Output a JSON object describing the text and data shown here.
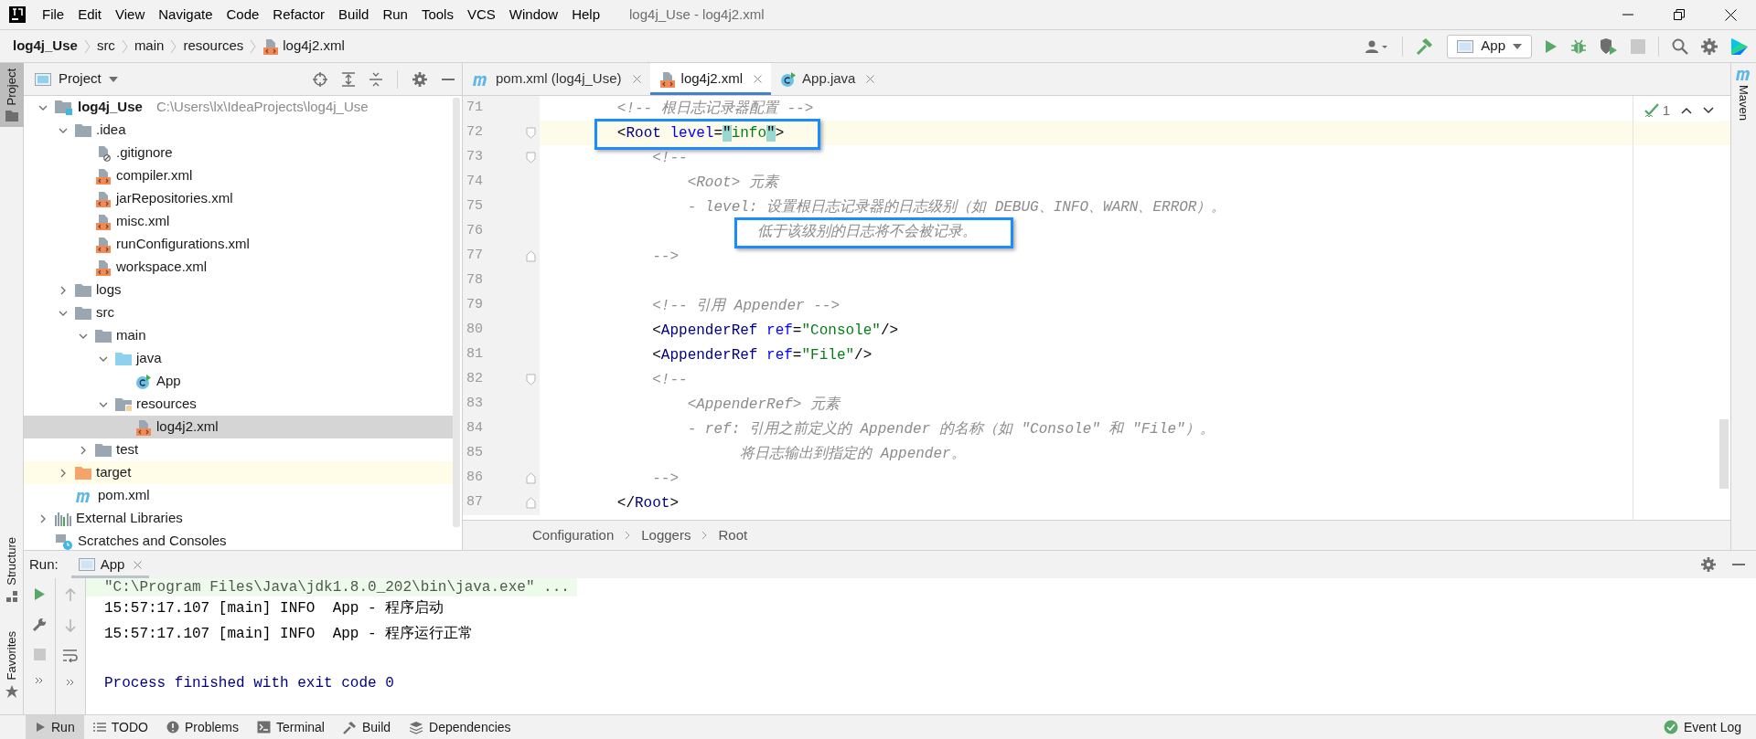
{
  "title_bar": {
    "menus": [
      "File",
      "Edit",
      "View",
      "Navigate",
      "Code",
      "Refactor",
      "Build",
      "Run",
      "Tools",
      "VCS",
      "Window",
      "Help"
    ],
    "title": "log4j_Use - log4j2.xml"
  },
  "nav_bar": {
    "breadcrumbs": [
      {
        "label": "log4j_Use",
        "kind": "project"
      },
      {
        "label": "src",
        "kind": "folder"
      },
      {
        "label": "main",
        "kind": "folder"
      },
      {
        "label": "resources",
        "kind": "folder"
      },
      {
        "label": "log4j2.xml",
        "kind": "xml"
      }
    ],
    "run_config": "App",
    "stop_disabled": true
  },
  "left_stripe": [
    {
      "label": "Project",
      "selected": true
    },
    {
      "label": "Structure",
      "selected": false
    },
    {
      "label": "Favorites",
      "selected": false
    }
  ],
  "right_stripe": [
    "Maven"
  ],
  "project_panel": {
    "title": "Project",
    "tree": [
      {
        "label": "log4j_Use",
        "path": "C:\\Users\\lx\\IdeaProjects\\log4j_Use",
        "kind": "module",
        "expanded": true,
        "selected": false,
        "children": [
          {
            "label": ".idea",
            "kind": "folder",
            "expanded": true,
            "selected": false,
            "children": [
              {
                "label": ".gitignore",
                "kind": "ignored",
                "selected": false
              },
              {
                "label": "compiler.xml",
                "kind": "xml",
                "selected": false
              },
              {
                "label": "jarRepositories.xml",
                "kind": "xml",
                "selected": false
              },
              {
                "label": "misc.xml",
                "kind": "xml",
                "selected": false
              },
              {
                "label": "runConfigurations.xml",
                "kind": "xml",
                "selected": false
              },
              {
                "label": "workspace.xml",
                "kind": "xml",
                "selected": false
              }
            ]
          },
          {
            "label": "logs",
            "kind": "folder",
            "expanded": false,
            "selected": false
          },
          {
            "label": "src",
            "kind": "folder",
            "expanded": true,
            "selected": false,
            "children": [
              {
                "label": "main",
                "kind": "folder",
                "expanded": true,
                "selected": false,
                "children": [
                  {
                    "label": "java",
                    "kind": "source",
                    "expanded": true,
                    "selected": false,
                    "children": [
                      {
                        "label": "App",
                        "kind": "class",
                        "selected": false
                      }
                    ]
                  },
                  {
                    "label": "resources",
                    "kind": "resources",
                    "expanded": true,
                    "selected": false,
                    "children": [
                      {
                        "label": "log4j2.xml",
                        "kind": "xml",
                        "selected": true
                      }
                    ]
                  }
                ]
              },
              {
                "label": "test",
                "kind": "folder",
                "expanded": false,
                "selected": false
              }
            ]
          },
          {
            "label": "target",
            "kind": "excluded",
            "expanded": false,
            "selected": false
          },
          {
            "label": "pom.xml",
            "kind": "maven",
            "selected": false
          }
        ]
      },
      {
        "label": "External Libraries",
        "kind": "libraries",
        "expanded": false,
        "selected": false
      },
      {
        "label": "Scratches and Consoles",
        "kind": "scratches",
        "selected": false
      }
    ]
  },
  "editor": {
    "tabs": [
      {
        "label": "pom.xml (log4j_Use)",
        "kind": "maven",
        "selected": false
      },
      {
        "label": "log4j2.xml",
        "kind": "xml",
        "selected": true
      },
      {
        "label": "App.java",
        "kind": "class",
        "selected": false
      }
    ],
    "inspection_count": "1",
    "lines": [
      {
        "number": "71",
        "kind": "plain",
        "current": false,
        "boxed": false,
        "tokens": [
          {
            "text": "        <!-- 根日志记录器配置 -->",
            "kind": "comment"
          }
        ]
      },
      {
        "number": "72",
        "kind": "opener",
        "current": true,
        "boxed": true,
        "tokens": [
          {
            "text": "        <",
            "kind": "punct"
          },
          {
            "text": "Root",
            "kind": "tag"
          },
          {
            "text": " level",
            "kind": "attr"
          },
          {
            "text": "=",
            "kind": "punct"
          },
          {
            "text": "\"",
            "kind": "match"
          },
          {
            "text": "info",
            "kind": "string",
            "caret_after": true
          },
          {
            "text": "\"",
            "kind": "match"
          },
          {
            "text": ">",
            "kind": "punct"
          }
        ]
      },
      {
        "number": "73",
        "kind": "opener",
        "current": false,
        "boxed": false,
        "tokens": [
          {
            "text": "            <!--",
            "kind": "comment"
          }
        ]
      },
      {
        "number": "74",
        "kind": "plain",
        "current": false,
        "boxed": false,
        "tokens": [
          {
            "text": "                <Root> 元素",
            "kind": "comment"
          }
        ]
      },
      {
        "number": "75",
        "kind": "plain",
        "current": false,
        "boxed": false,
        "tokens": [
          {
            "text": "                - level: 设置根日志记录器的日志级别（如 DEBUG、INFO、WARN、ERROR）。",
            "kind": "comment"
          }
        ]
      },
      {
        "number": "76",
        "kind": "plain",
        "current": false,
        "boxed": true,
        "tokens": [
          {
            "text": "                        低于该级别的日志将不会被记录。",
            "kind": "comment"
          }
        ]
      },
      {
        "number": "77",
        "kind": "closer",
        "current": false,
        "boxed": false,
        "tokens": [
          {
            "text": "            -->",
            "kind": "comment"
          }
        ]
      },
      {
        "number": "78",
        "kind": "plain",
        "current": false,
        "boxed": false
      },
      {
        "number": "79",
        "kind": "plain",
        "current": false,
        "boxed": false,
        "tokens": [
          {
            "text": "            <!-- 引用 Appender -->",
            "kind": "comment"
          }
        ]
      },
      {
        "number": "80",
        "kind": "plain",
        "current": false,
        "boxed": false,
        "tokens": [
          {
            "text": "            <",
            "kind": "punct"
          },
          {
            "text": "AppenderRef",
            "kind": "tag"
          },
          {
            "text": " ref",
            "kind": "attr"
          },
          {
            "text": "=",
            "kind": "punct"
          },
          {
            "text": "\"Console\"",
            "kind": "string"
          },
          {
            "text": "/>",
            "kind": "punct"
          }
        ]
      },
      {
        "number": "81",
        "kind": "plain",
        "current": false,
        "boxed": false,
        "tokens": [
          {
            "text": "            <",
            "kind": "punct"
          },
          {
            "text": "AppenderRef",
            "kind": "tag"
          },
          {
            "text": " ref",
            "kind": "attr"
          },
          {
            "text": "=",
            "kind": "punct"
          },
          {
            "text": "\"File\"",
            "kind": "string"
          },
          {
            "text": "/>",
            "kind": "punct"
          }
        ]
      },
      {
        "number": "82",
        "kind": "opener",
        "current": false,
        "boxed": false,
        "tokens": [
          {
            "text": "            <!--",
            "kind": "comment"
          }
        ]
      },
      {
        "number": "83",
        "kind": "plain",
        "current": false,
        "boxed": false,
        "tokens": [
          {
            "text": "                <AppenderRef> 元素",
            "kind": "comment"
          }
        ]
      },
      {
        "number": "84",
        "kind": "plain",
        "current": false,
        "boxed": false,
        "tokens": [
          {
            "text": "                - ref: 引用之前定义的 Appender 的名称（如 \"Console\" 和 \"File\"）。",
            "kind": "comment"
          }
        ]
      },
      {
        "number": "85",
        "kind": "plain",
        "current": false,
        "boxed": false,
        "tokens": [
          {
            "text": "                      将日志输出到指定的 Appender。",
            "kind": "comment"
          }
        ]
      },
      {
        "number": "86",
        "kind": "closer",
        "current": false,
        "boxed": false,
        "tokens": [
          {
            "text": "            -->",
            "kind": "comment"
          }
        ]
      },
      {
        "number": "87",
        "kind": "closer",
        "current": false,
        "boxed": false,
        "tokens": [
          {
            "text": "        </",
            "kind": "punct"
          },
          {
            "text": "Root",
            "kind": "tag"
          },
          {
            "text": ">",
            "kind": "punct"
          }
        ]
      }
    ],
    "breadcrumbs": [
      "Configuration",
      "Loggers",
      "Root"
    ]
  },
  "run_panel": {
    "label": "Run:",
    "tab": "App",
    "console": [
      {
        "text": "\"C:\\Program Files\\Java\\jdk1.8.0_202\\bin\\java.exe\" ...",
        "kind": "command"
      },
      {
        "text": "15:57:17.107 [main] INFO  App - 程序启动",
        "kind": "log"
      },
      {
        "text": "15:57:17.107 [main] INFO  App - 程序运行正常",
        "kind": "log"
      },
      {
        "text": "Process finished with exit code 0",
        "kind": "exit"
      }
    ]
  },
  "bottom_bar": {
    "tools": [
      {
        "label": "Run",
        "kind": "run",
        "selected": true
      },
      {
        "label": "TODO",
        "kind": "todo",
        "selected": false
      },
      {
        "label": "Problems",
        "kind": "problems",
        "selected": false
      },
      {
        "label": "Terminal",
        "kind": "terminal",
        "selected": false
      },
      {
        "label": "Build",
        "kind": "build",
        "selected": false
      },
      {
        "label": "Dependencies",
        "kind": "dependencies",
        "selected": false
      }
    ],
    "event_log": "Event Log"
  }
}
